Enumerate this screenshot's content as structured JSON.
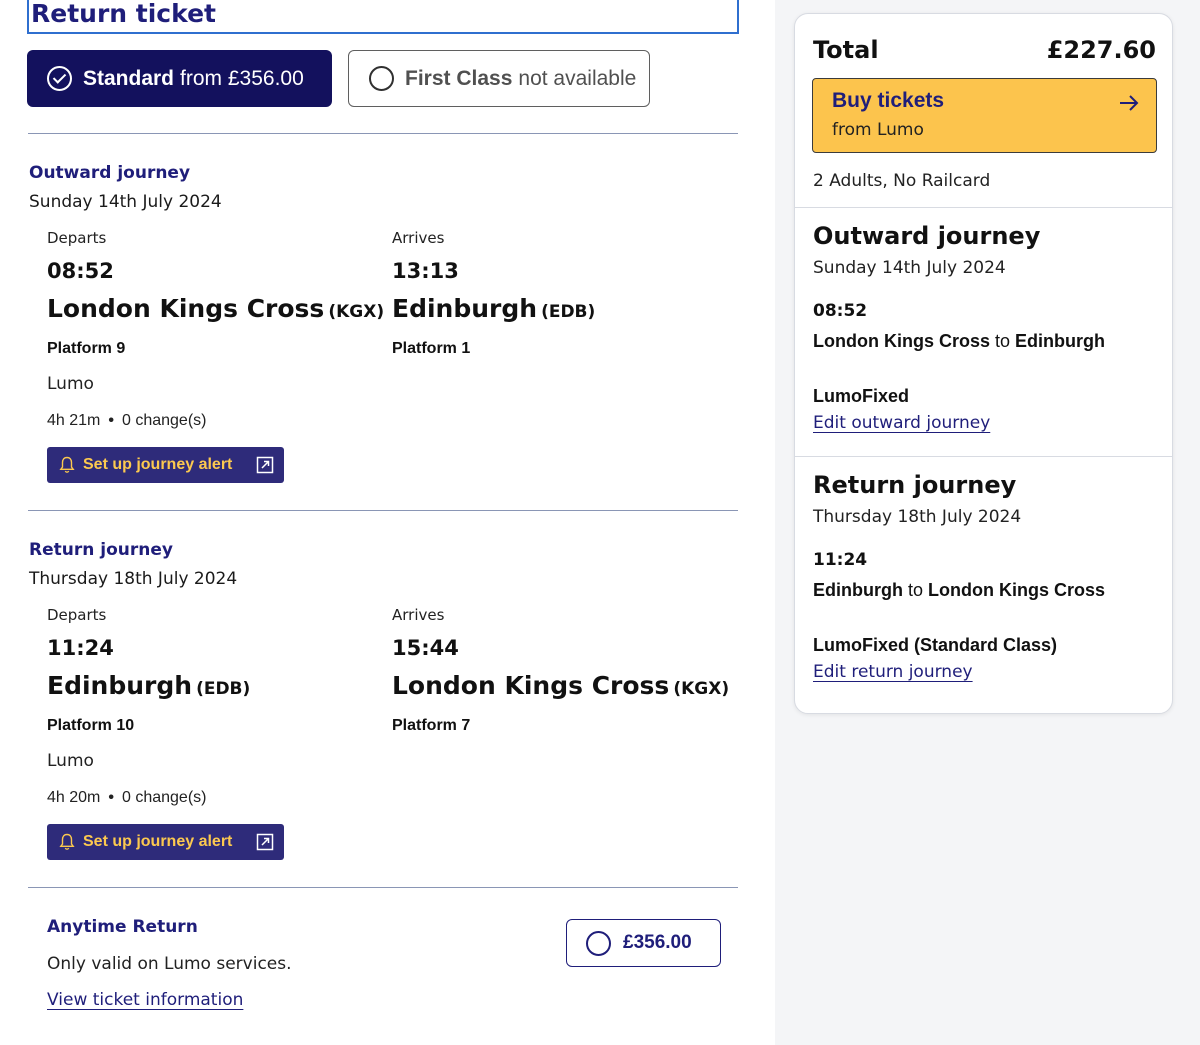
{
  "ticket_type": {
    "title": "Return ticket",
    "standard": {
      "bold": "Standard",
      "rest": "from £356.00"
    },
    "first": {
      "bold": "First Class",
      "rest": "not available"
    }
  },
  "outward": {
    "heading": "Outward journey",
    "date": "Sunday 14th July 2024",
    "departs_label": "Departs",
    "arrives_label": "Arrives",
    "dep_time": "08:52",
    "arr_time": "13:13",
    "dep_station": "London Kings Cross",
    "dep_code": "(KGX)",
    "arr_station": "Edinburgh",
    "arr_code": "(EDB)",
    "dep_platform": "Platform 9",
    "arr_platform": "Platform 1",
    "operator": "Lumo",
    "duration": "4h 21m",
    "changes": "0 change(s)",
    "alert_label": "Set up journey alert"
  },
  "return": {
    "heading": "Return journey",
    "date": "Thursday 18th July 2024",
    "departs_label": "Departs",
    "arrives_label": "Arrives",
    "dep_time": "11:24",
    "arr_time": "15:44",
    "dep_station": "Edinburgh",
    "dep_code": "(EDB)",
    "arr_station": "London Kings Cross",
    "arr_code": "(KGX)",
    "dep_platform": "Platform 10",
    "arr_platform": "Platform 7",
    "operator": "Lumo",
    "duration": "4h 20m",
    "changes": "0 change(s)",
    "alert_label": "Set up journey alert"
  },
  "fare": {
    "name": "Anytime Return",
    "description": "Only valid on Lumo services.",
    "link": "View ticket information",
    "price": "£356.00"
  },
  "summary": {
    "total_label": "Total",
    "total_value": "£227.60",
    "buy_label": "Buy tickets",
    "buy_sub": "from Lumo",
    "passengers": "2 Adults, No Railcard",
    "outward": {
      "heading": "Outward journey",
      "date": "Sunday 14th July 2024",
      "time": "08:52",
      "from": "London Kings Cross",
      "to_word": "to",
      "to": "Edinburgh",
      "fare": "LumoFixed",
      "edit": "Edit outward journey"
    },
    "return": {
      "heading": "Return journey",
      "date": "Thursday 18th July 2024",
      "time": "11:24",
      "from": "Edinburgh",
      "to_word": "to",
      "to": "London Kings Cross",
      "fare": "LumoFixed (Standard Class)",
      "edit": "Edit return journey"
    }
  },
  "colors": {
    "navy": "#1f1e7a",
    "selected_bg": "#13115d",
    "alert_bg": "#2e2b7a",
    "alert_text": "#fcc94f",
    "buy_bg": "#fcc44d",
    "focus_border": "#2f6fcf"
  },
  "icons": [
    "check-circle-icon",
    "empty-radio-icon",
    "bell-icon",
    "external-link-icon",
    "arrow-right-icon"
  ]
}
